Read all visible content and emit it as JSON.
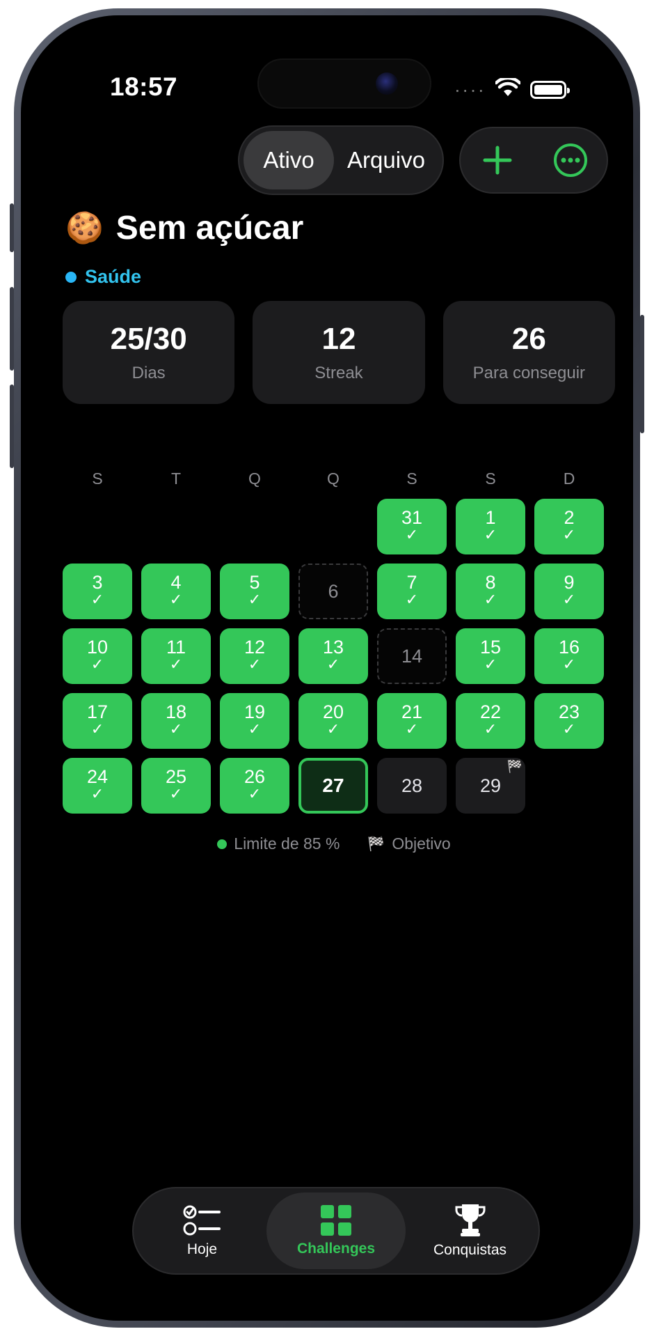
{
  "status_bar": {
    "time": "18:57"
  },
  "segmented": {
    "active": "Ativo",
    "archive": "Arquivo"
  },
  "header": {
    "emoji": "🍪",
    "title": "Sem açúcar",
    "category": "Saúde"
  },
  "stats": [
    {
      "value": "25/30",
      "label": "Dias"
    },
    {
      "value": "12",
      "label": "Streak"
    },
    {
      "value": "26",
      "label": "Para conseguir"
    }
  ],
  "calendar": {
    "weekdays": [
      "S",
      "T",
      "Q",
      "Q",
      "S",
      "S",
      "D"
    ],
    "check": "✓",
    "flag": "🏁",
    "days": [
      {
        "day": "",
        "state": "empty"
      },
      {
        "day": "",
        "state": "empty"
      },
      {
        "day": "",
        "state": "empty"
      },
      {
        "day": "",
        "state": "empty"
      },
      {
        "day": "31",
        "state": "done"
      },
      {
        "day": "1",
        "state": "done"
      },
      {
        "day": "2",
        "state": "done"
      },
      {
        "day": "3",
        "state": "done"
      },
      {
        "day": "4",
        "state": "done"
      },
      {
        "day": "5",
        "state": "done"
      },
      {
        "day": "6",
        "state": "missed"
      },
      {
        "day": "7",
        "state": "done"
      },
      {
        "day": "8",
        "state": "done"
      },
      {
        "day": "9",
        "state": "done"
      },
      {
        "day": "10",
        "state": "done"
      },
      {
        "day": "11",
        "state": "done"
      },
      {
        "day": "12",
        "state": "done"
      },
      {
        "day": "13",
        "state": "done"
      },
      {
        "day": "14",
        "state": "missed"
      },
      {
        "day": "15",
        "state": "done"
      },
      {
        "day": "16",
        "state": "done"
      },
      {
        "day": "17",
        "state": "done"
      },
      {
        "day": "18",
        "state": "done"
      },
      {
        "day": "19",
        "state": "done"
      },
      {
        "day": "20",
        "state": "done"
      },
      {
        "day": "21",
        "state": "done"
      },
      {
        "day": "22",
        "state": "done"
      },
      {
        "day": "23",
        "state": "done"
      },
      {
        "day": "24",
        "state": "done"
      },
      {
        "day": "25",
        "state": "done"
      },
      {
        "day": "26",
        "state": "done"
      },
      {
        "day": "27",
        "state": "today"
      },
      {
        "day": "28",
        "state": "future"
      },
      {
        "day": "29",
        "state": "goal"
      }
    ]
  },
  "legend": {
    "limit": "Limite de 85 %",
    "goal": "Objetivo"
  },
  "tabs": [
    {
      "label": "Hoje",
      "icon": "checklist-icon"
    },
    {
      "label": "Challenges",
      "icon": "grid-icon"
    },
    {
      "label": "Conquistas",
      "icon": "trophy-icon"
    }
  ],
  "colors": {
    "accent": "#34c759",
    "card": "#1c1c1e",
    "category": "#32c3ee"
  }
}
